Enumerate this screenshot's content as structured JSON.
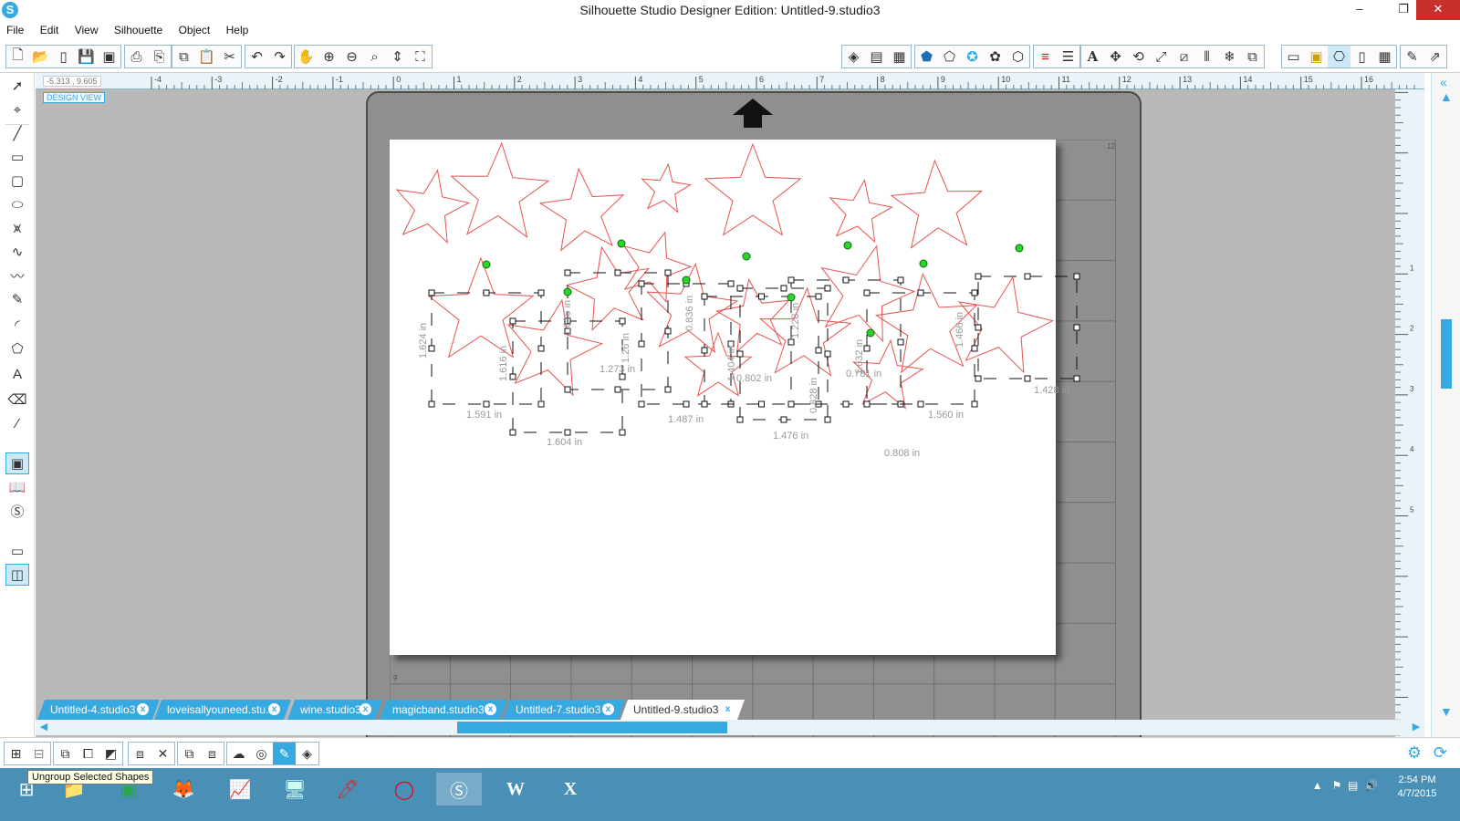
{
  "window": {
    "title": "Silhouette Studio Designer Edition: Untitled-9.studio3",
    "minimize": "–",
    "restore": "❐",
    "close": "✕"
  },
  "menu": [
    "File",
    "Edit",
    "View",
    "Silhouette",
    "Object",
    "Help"
  ],
  "ruler": {
    "coord_readout": "-5.313 , 9.605",
    "design_view_label": "DESIGN VIEW",
    "h_ticks": [
      "-4",
      "-3",
      "-2",
      "-1",
      "0",
      "1",
      "2",
      "3",
      "4",
      "5",
      "6",
      "7",
      "8",
      "9",
      "10",
      "11",
      "12",
      "13",
      "14",
      "15",
      "16"
    ],
    "v_ticks": [
      "1",
      "2",
      "3",
      "4",
      "5"
    ],
    "mat_corner_top": "12",
    "mat_corner_bottom": "9"
  },
  "dimensions": {
    "d1": "1.624 in",
    "d2": "1.591 in",
    "d3": "1.616 in",
    "d4": "1.604 in",
    "d5": "1.616 in",
    "d6": "1.273 in",
    "d7": "1.26 in",
    "d8": "0.836 in",
    "d9": "1.487 in",
    "d10": "1.404 in",
    "d11": "0.802 in",
    "d12": "1.476 in",
    "d13": "1.228 in",
    "d14": "0.828 in",
    "d15": "0.781 in",
    "d16": "1.632 in",
    "d17": "1.560 in",
    "d18": "0.808 in",
    "d19": "1.466 in",
    "d20": "1.428 in"
  },
  "tabs": [
    {
      "label": "Untitled-4.studio3",
      "close": "x"
    },
    {
      "label": "loveisallyouneed.stu...",
      "close": "x"
    },
    {
      "label": "wine.studio3",
      "close": "x"
    },
    {
      "label": "magicband.studio3",
      "close": "x"
    },
    {
      "label": "Untitled-7.studio3",
      "close": "x"
    },
    {
      "label": "Untitled-9.studio3",
      "close": "x"
    }
  ],
  "tooltip": "Ungroup Selected Shapes",
  "taskbar": {
    "time": "2:54 PM",
    "date": "4/7/2015"
  },
  "colors": {
    "accent": "#36a9e1",
    "star_outline": "#e8524f",
    "handle_rotate": "#2bd62b",
    "taskbar": "#4a8fb5"
  },
  "icons": {
    "toolbar_left": [
      "new-icon",
      "open-icon",
      "template-icon",
      "save-icon",
      "save-as-icon",
      "print-icon",
      "print-cut-icon",
      "copy-icon",
      "paste-icon",
      "cut-icon",
      "undo-icon",
      "redo-icon",
      "pan-icon",
      "zoom-in-icon",
      "zoom-out-icon",
      "zoom-select-icon",
      "zoom-drag-icon",
      "fit-to-page-icon"
    ],
    "toolbar_right": [
      "page-setup-icon",
      "grid-icon",
      "registration-icon",
      "fill-color-icon",
      "line-color-icon",
      "line-style-icon",
      "gradient-icon",
      "pattern-icon",
      "layers-icon",
      "line-icon",
      "text-icon",
      "transform-icon",
      "rotate-icon",
      "scale-icon",
      "shear-icon",
      "align-icon",
      "replicate-icon",
      "modify-icon",
      "offset-icon",
      "trace-icon",
      "cut-settings-icon",
      "send-to-silhouette-icon",
      "library-icon",
      "store-icon",
      "design-page-icon",
      "points-icon",
      "draw-icon",
      "settings-icon"
    ]
  }
}
